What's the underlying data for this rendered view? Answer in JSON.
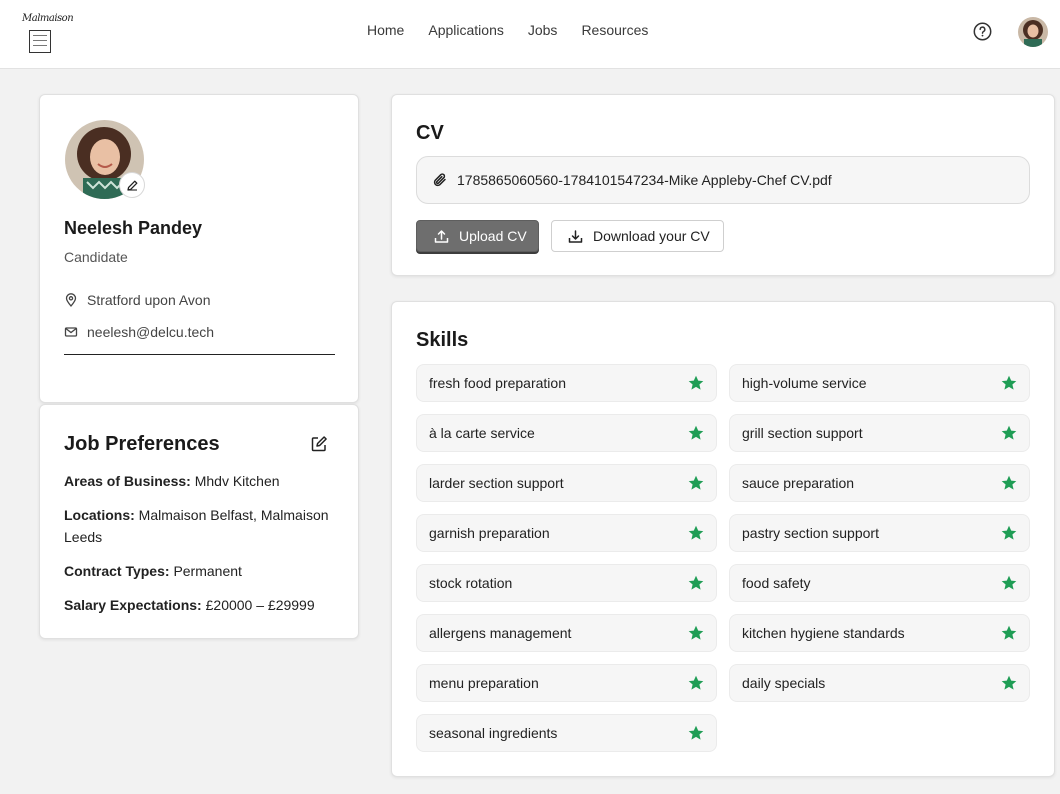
{
  "logo": {
    "script_text": "Malmaison"
  },
  "nav": {
    "items": [
      "Home",
      "Applications",
      "Jobs",
      "Resources"
    ]
  },
  "header": {
    "help_icon": "help-circle-icon"
  },
  "profile": {
    "name": "Neelesh Pandey",
    "role": "Candidate",
    "location": "Stratford upon Avon",
    "email": "neelesh@delcu.tech"
  },
  "preferences": {
    "title": "Job Preferences",
    "items": [
      {
        "label": "Areas of Business:",
        "value": "Mhdv Kitchen"
      },
      {
        "label": "Locations:",
        "value": "Malmaison Belfast, Malmaison Leeds"
      },
      {
        "label": "Contract Types:",
        "value": "Permanent"
      },
      {
        "label": "Salary Expectations:",
        "value": "£20000 – £29999"
      }
    ]
  },
  "cv": {
    "title": "CV",
    "file_name": "1785865060560-1784101547234-Mike Appleby-Chef CV.pdf",
    "upload_label": "Upload CV",
    "download_label": "Download your CV"
  },
  "skills": {
    "title": "Skills",
    "star_color": "#1f9d55",
    "items": [
      "fresh food preparation",
      "high-volume service",
      "à la carte service",
      "grill section support",
      "larder section support",
      "sauce preparation",
      "garnish preparation",
      "pastry section support",
      "stock rotation",
      "food safety",
      "allergens management",
      "kitchen hygiene standards",
      "menu preparation",
      "daily specials",
      "seasonal ingredients"
    ]
  }
}
